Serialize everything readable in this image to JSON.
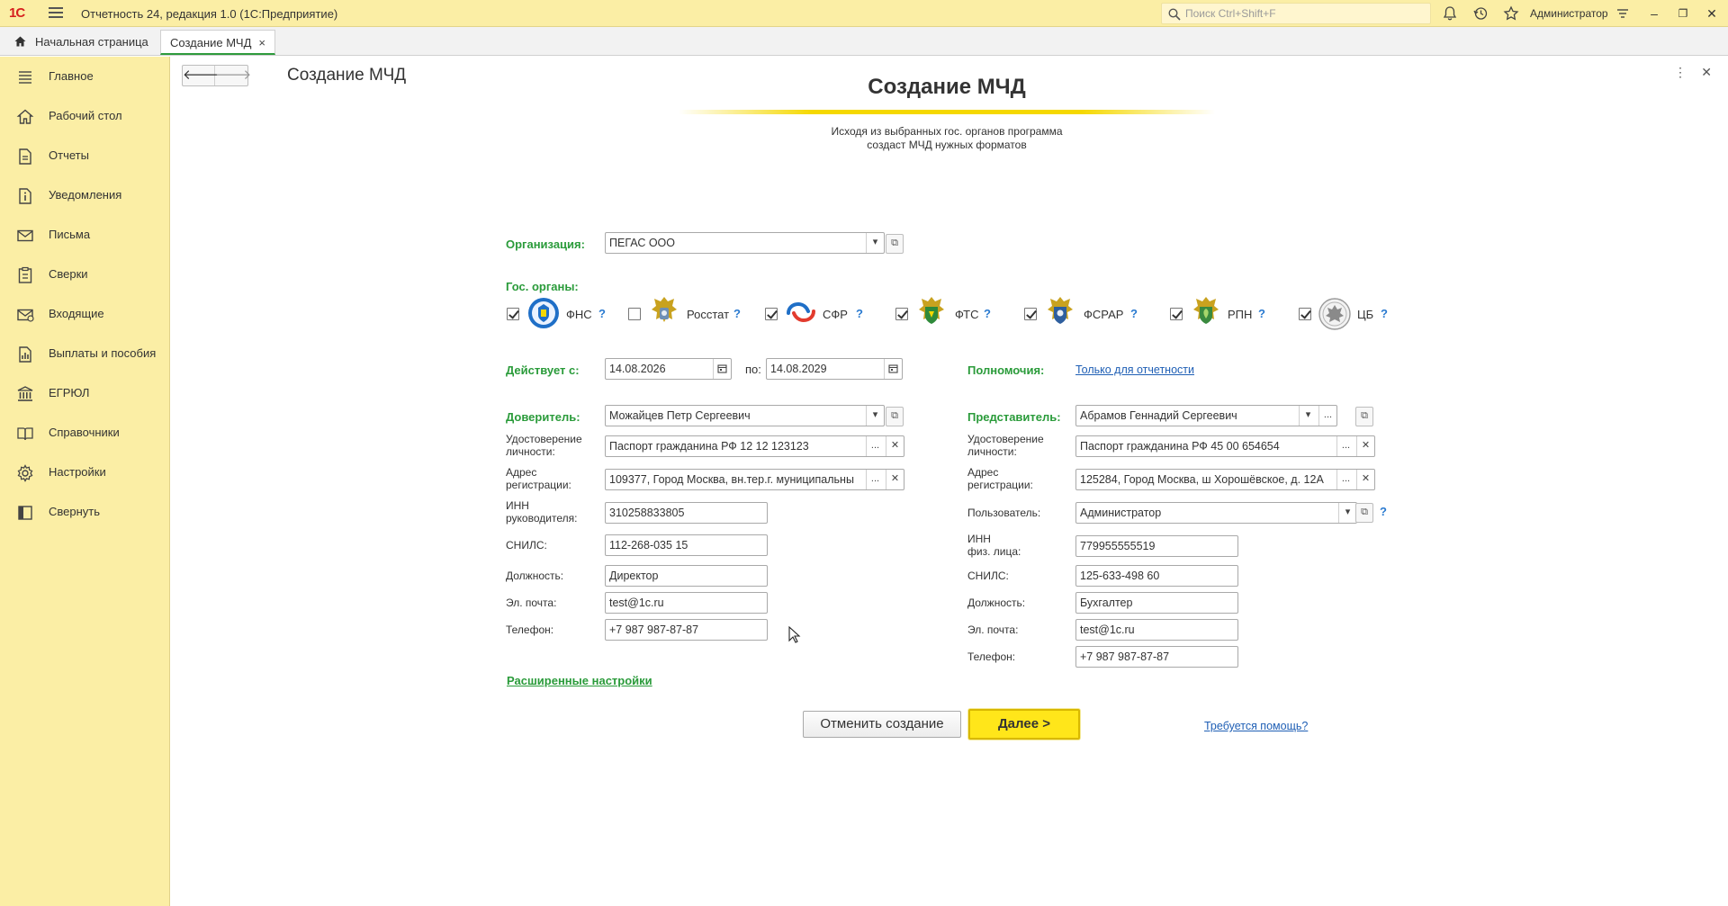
{
  "titlebar": {
    "logo": "1С",
    "app_title": "Отчетность 24, редакция 1.0  (1С:Предприятие)",
    "search_placeholder": "Поиск Ctrl+Shift+F",
    "user": "Администратор"
  },
  "tabs": {
    "home": "Начальная страница",
    "active": "Создание МЧД",
    "close": "×"
  },
  "sidebar": {
    "items": [
      {
        "label": "Главное",
        "icon": "menu-icon"
      },
      {
        "label": "Рабочий стол",
        "icon": "home-icon"
      },
      {
        "label": "Отчеты",
        "icon": "document-icon"
      },
      {
        "label": "Уведомления",
        "icon": "info-icon"
      },
      {
        "label": "Письма",
        "icon": "mail-icon"
      },
      {
        "label": "Сверки",
        "icon": "checklist-icon"
      },
      {
        "label": "Входящие",
        "icon": "inbox-icon"
      },
      {
        "label": "Выплаты и пособия",
        "icon": "payments-icon"
      },
      {
        "label": "ЕГРЮЛ",
        "icon": "bank-icon"
      },
      {
        "label": "Справочники",
        "icon": "book-icon"
      },
      {
        "label": "Настройки",
        "icon": "gear-icon"
      },
      {
        "label": "Свернуть",
        "icon": "collapse-icon"
      }
    ]
  },
  "page": {
    "title": "Создание МЧД",
    "form_title": "Создание МЧД",
    "subtitle_line1": "Исходя из выбранных гос. органов программа",
    "subtitle_line2": "создаст МЧД нужных форматов"
  },
  "form": {
    "org_label": "Организация:",
    "org_value": "ПЕГАС ООО",
    "agencies_label": "Гос. органы:",
    "agencies": [
      {
        "name": "ФНС",
        "checked": true
      },
      {
        "name": "Росстат",
        "checked": false
      },
      {
        "name": "СФР",
        "checked": true
      },
      {
        "name": "ФТС",
        "checked": true
      },
      {
        "name": "ФСРАР",
        "checked": true
      },
      {
        "name": "РПН",
        "checked": true
      },
      {
        "name": "ЦБ",
        "checked": true
      }
    ],
    "help_mark": "?",
    "valid_from_label": "Действует с:",
    "valid_from": "14.08.2026",
    "valid_to_label": "по:",
    "valid_to": "14.08.2029",
    "powers_label": "Полномочия:",
    "powers_value": "Только для отчетности",
    "principal": {
      "section_label": "Доверитель:",
      "name": "Можайцев Петр Сергеевич",
      "id_label_1": "Удостоверение",
      "id_label_2": "личности:",
      "id_value": "Паспорт гражданина РФ 12 12 123123",
      "addr_label_1": "Адрес",
      "addr_label_2": "регистрации:",
      "addr_value": "109377, Город Москва, вн.тер.г. муниципальны",
      "inn_label_1": "ИНН",
      "inn_label_2": "руководителя:",
      "inn_value": "310258833805",
      "snils_label": "СНИЛС:",
      "snils_value": "112-268-035 15",
      "position_label": "Должность:",
      "position_value": "Директор",
      "email_label": "Эл. почта:",
      "email_value": "test@1c.ru",
      "phone_label": "Телефон:",
      "phone_value": "+7 987 987-87-87"
    },
    "representative": {
      "section_label": "Представитель:",
      "name": "Абрамов Геннадий Сергеевич",
      "id_label_1": "Удостоверение",
      "id_label_2": "личности:",
      "id_value": "Паспорт гражданина РФ 45 00 654654",
      "addr_label_1": "Адрес",
      "addr_label_2": "регистрации:",
      "addr_value": "125284, Город Москва, ш Хорошёвское, д. 12А",
      "user_label": "Пользователь:",
      "user_value": "Администратор",
      "inn_label_1": "ИНН",
      "inn_label_2": "физ. лица:",
      "inn_value": "779955555519",
      "snils_label": "СНИЛС:",
      "snils_value": "125-633-498 60",
      "position_label": "Должность:",
      "position_value": "Бухгалтер",
      "email_label": "Эл. почта:",
      "email_value": "test@1c.ru",
      "phone_label": "Телефон:",
      "phone_value": "+7 987 987-87-87"
    },
    "advanced_link": "Расширенные настройки",
    "cancel_button": "Отменить создание",
    "next_button": "Далее >",
    "help_link": "Требуется помощь?"
  },
  "colors": {
    "accent_yellow": "#fbeea5",
    "label_green": "#2a9b3a",
    "link_blue": "#1f5fb5",
    "next_button": "#ffe61a"
  }
}
